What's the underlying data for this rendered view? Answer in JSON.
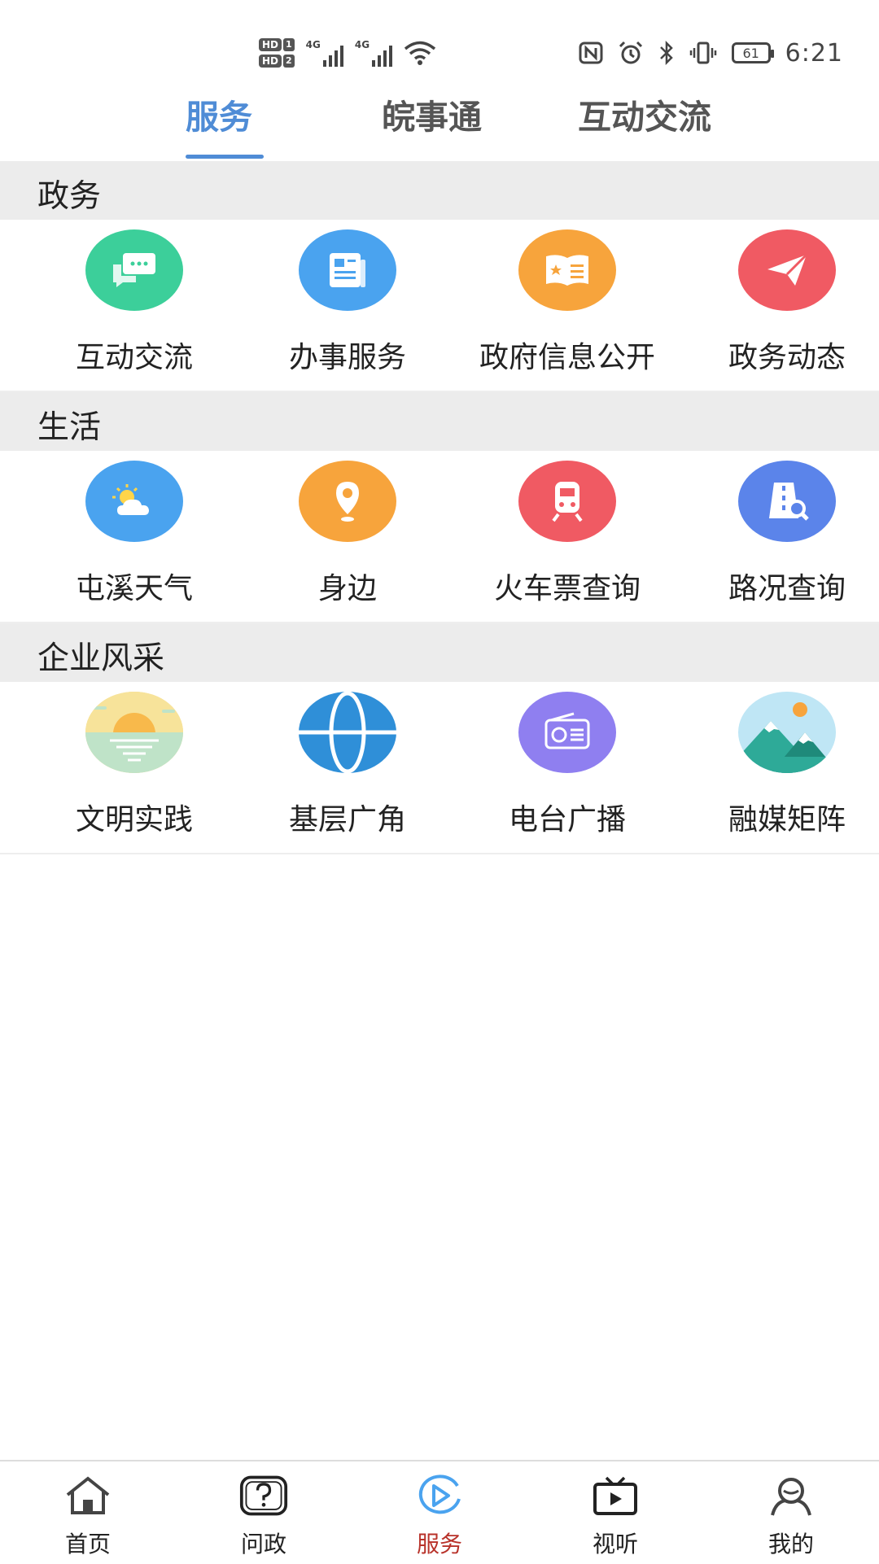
{
  "status_bar": {
    "hd1": "HD",
    "hd1_num": "1",
    "hd2": "HD",
    "hd2_num": "2",
    "net1": "4G",
    "net2": "4G",
    "battery": "61",
    "time": "6:21"
  },
  "tabs": [
    {
      "label": "服务",
      "active": true
    },
    {
      "label": "皖事通",
      "active": false
    },
    {
      "label": "互动交流",
      "active": false
    }
  ],
  "sections": [
    {
      "title": "政务",
      "items": [
        {
          "label": "互动交流",
          "icon": "chat-bubbles-icon",
          "color": "#3ccf9a"
        },
        {
          "label": "办事服务",
          "icon": "document-icon",
          "color": "#4aa3ef"
        },
        {
          "label": "政府信息公开",
          "icon": "open-book-icon",
          "color": "#f7a43c"
        },
        {
          "label": "政务动态",
          "icon": "paper-plane-icon",
          "color": "#f05a63"
        }
      ]
    },
    {
      "title": "生活",
      "items": [
        {
          "label": "屯溪天气",
          "icon": "weather-icon",
          "color": "#4aa3ef"
        },
        {
          "label": "身边",
          "icon": "location-pin-icon",
          "color": "#f7a43c"
        },
        {
          "label": "火车票查询",
          "icon": "train-icon",
          "color": "#f05a63"
        },
        {
          "label": "路况查询",
          "icon": "road-search-icon",
          "color": "#5b84ea"
        }
      ]
    },
    {
      "title": "企业风采",
      "items": [
        {
          "label": "文明实践",
          "icon": "sunrise-icon",
          "color": "#f5d77a"
        },
        {
          "label": "基层广角",
          "icon": "globe-icon",
          "color": "#2f8fd8"
        },
        {
          "label": "电台广播",
          "icon": "radio-icon",
          "color": "#8f7ff0"
        },
        {
          "label": "融媒矩阵",
          "icon": "mountains-icon",
          "color": "#bfe6f5"
        }
      ]
    }
  ],
  "bottom_nav": [
    {
      "label": "首页",
      "icon": "home-icon",
      "active": false
    },
    {
      "label": "问政",
      "icon": "question-icon",
      "active": false
    },
    {
      "label": "服务",
      "icon": "play-circle-icon",
      "active": true
    },
    {
      "label": "视听",
      "icon": "tv-icon",
      "active": false
    },
    {
      "label": "我的",
      "icon": "user-icon",
      "active": false
    }
  ]
}
